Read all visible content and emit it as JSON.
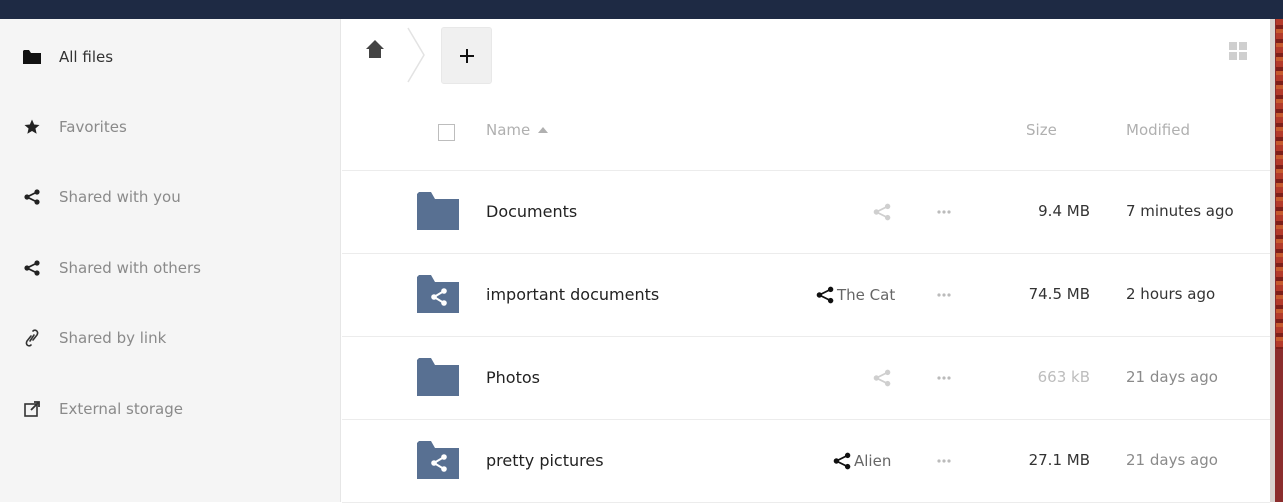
{
  "sidebar": {
    "items": [
      {
        "label": "All files",
        "icon": "folder-icon",
        "active": true
      },
      {
        "label": "Favorites",
        "icon": "star-icon",
        "active": false
      },
      {
        "label": "Shared with you",
        "icon": "share-icon",
        "active": false
      },
      {
        "label": "Shared with others",
        "icon": "share-icon",
        "active": false
      },
      {
        "label": "Shared by link",
        "icon": "link-icon",
        "active": false
      },
      {
        "label": "External storage",
        "icon": "external-link-icon",
        "active": false
      }
    ]
  },
  "breadcrumb": {
    "home_icon": "home-icon",
    "add_icon": "plus-icon"
  },
  "table": {
    "columns": {
      "name": "Name",
      "size": "Size",
      "modified": "Modified"
    },
    "rows": [
      {
        "name": "Documents",
        "type": "folder",
        "shared_with": "",
        "size": "9.4 MB",
        "modified": "7 minutes ago"
      },
      {
        "name": "important documents",
        "type": "shared-folder",
        "shared_with": "The Cat",
        "size": "74.5 MB",
        "modified": "2 hours ago"
      },
      {
        "name": "Photos",
        "type": "folder",
        "shared_with": "",
        "size": "663 kB",
        "modified": "21 days ago"
      },
      {
        "name": "pretty pictures",
        "type": "shared-folder",
        "shared_with": "Alien",
        "size": "27.1 MB",
        "modified": "21 days ago"
      }
    ]
  },
  "colors": {
    "topbar": "#1e2a44",
    "folder": "#587092",
    "sidebar_bg": "#f5f5f5"
  }
}
